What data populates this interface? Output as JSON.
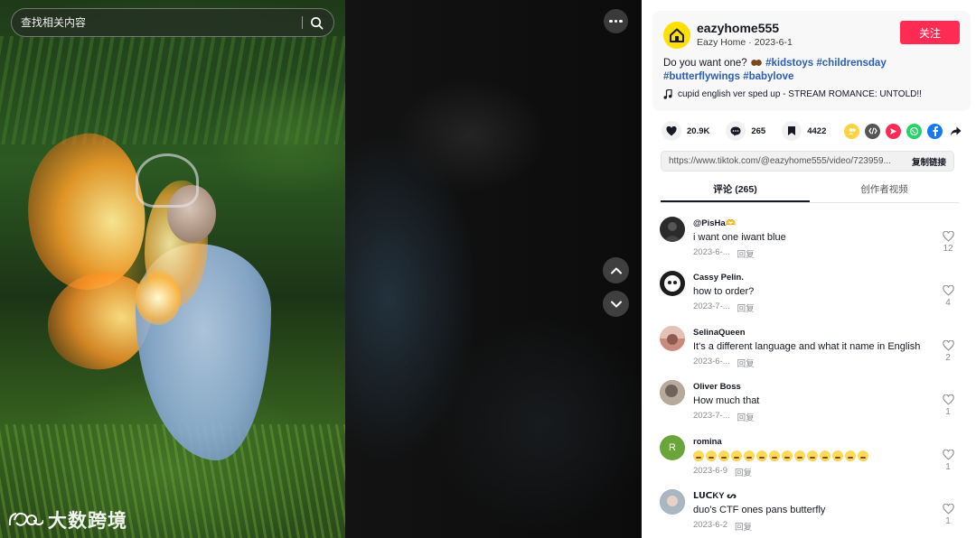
{
  "search": {
    "placeholder": "查找相关内容"
  },
  "watermark": {
    "text": "大数跨境"
  },
  "author": {
    "username": "eazyhome555",
    "nickname": "Eazy Home",
    "separator": "·",
    "date": "2023-6-1",
    "follow_label": "关注",
    "avatar_icon": "house-icon",
    "avatar_color": "#ffe000"
  },
  "description": {
    "text": "Do you want one?",
    "hashtags": [
      "#kidstoys",
      "#childrensday",
      "#butterflywings",
      "#babylove"
    ],
    "music": "cupid english ver sped up - STREAM ROMANCE: UNTOLD!!"
  },
  "stats": {
    "likes": "20.9K",
    "comments": "265",
    "saves": "4422"
  },
  "share_icons": [
    {
      "name": "friends-share-icon",
      "color": "#ffd23f"
    },
    {
      "name": "embed-icon",
      "color": "#555555"
    },
    {
      "name": "send-icon",
      "color": "#fe2c55"
    },
    {
      "name": "whatsapp-icon",
      "color": "#25d366"
    },
    {
      "name": "facebook-icon",
      "color": "#1877f2"
    },
    {
      "name": "forward-arrow-icon",
      "color": "#161823"
    }
  ],
  "link": {
    "url": "https://www.tiktok.com/@eazyhome555/video/723959...",
    "copy_label": "复制链接"
  },
  "tabs": [
    {
      "label": "评论 (265)",
      "active": true
    },
    {
      "label": "创作者视频",
      "active": false
    }
  ],
  "comments": [
    {
      "user": "@PisHa🫶",
      "text": "i want one iwant blue",
      "date": "2023-6-...",
      "reply": "回复",
      "likes": "12",
      "avatar_color": "#2a2a2a"
    },
    {
      "user": "Cassy Pelin.",
      "text": "how to order?",
      "date": "2023-7-...",
      "reply": "回复",
      "likes": "4",
      "avatar_color": "#1c1c1c"
    },
    {
      "user": "SelinaQueen",
      "text": "It's a different language and what it name in English",
      "date": "2023-6-...",
      "reply": "回复",
      "likes": "2",
      "avatar_color": "#c98b7d"
    },
    {
      "user": "Oliver Boss",
      "text": "How much that",
      "date": "2023-7-...",
      "reply": "回复",
      "likes": "1",
      "avatar_color": "#9b8e82"
    },
    {
      "user": "romina",
      "text": "",
      "date": "2023-6-9",
      "reply": "回复",
      "likes": "1",
      "avatar_color": "#6ba539",
      "avatar_letter": "R",
      "emoji_count": 14
    },
    {
      "user": "ᒪᑌᑕKY ᔕ",
      "text": "duo's CTF ones pans butterfly",
      "date": "2023-6-2",
      "reply": "回复",
      "likes": "1",
      "avatar_color": "#7d8a96"
    }
  ]
}
